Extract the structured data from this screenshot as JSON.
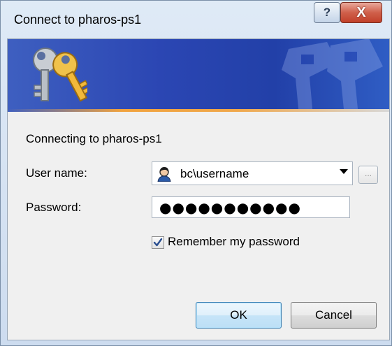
{
  "window": {
    "title": "Connect to pharos-ps1",
    "help_glyph": "?",
    "close_glyph": "X"
  },
  "banner": {
    "icon": "keys-icon",
    "watermark": "keys-watermark",
    "colors": {
      "banner": "#2b46b3",
      "accent": "#f1a23d"
    }
  },
  "form": {
    "connecting_text": "Connecting to pharos-ps1",
    "username_label": "User name:",
    "username_value": "bc\\username",
    "password_label": "Password:",
    "password_mask": "●●●●●●●●●●●",
    "browse_label": "...",
    "remember_label": "Remember my password",
    "remember_checked": true
  },
  "buttons": {
    "ok": "OK",
    "cancel": "Cancel"
  }
}
